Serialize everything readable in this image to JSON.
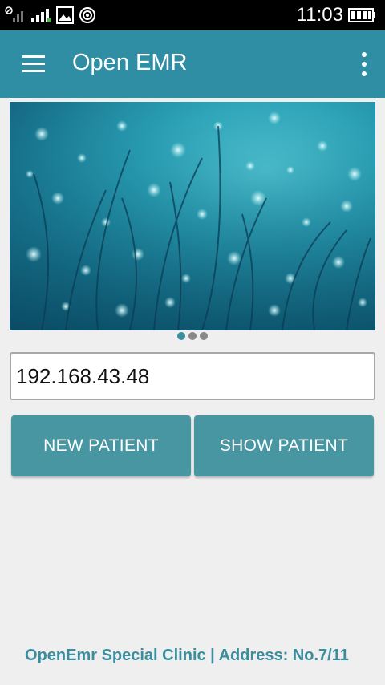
{
  "status_bar": {
    "time": "11:03",
    "icons": [
      "blocked-signal-icon",
      "signal-icon",
      "image-icon",
      "wifi-hotspot-icon",
      "battery-icon"
    ]
  },
  "app_bar": {
    "title": "Open EMR",
    "menu_icon": "hamburger-menu-icon",
    "overflow_icon": "more-vert-icon"
  },
  "banner": {
    "description_icon": "water-drops-grass-image",
    "page_indicator": {
      "count": 3,
      "active_index": 0
    }
  },
  "server_ip": {
    "value": "192.168.43.48"
  },
  "buttons": {
    "new_patient": "NEW PATIENT",
    "show_patient": "SHOW PATIENT"
  },
  "footer": {
    "text": "OpenEmr Special Clinic | Address: No.7/11"
  },
  "colors": {
    "primary": "#2f8ea4",
    "button": "#4896a1",
    "footer_text": "#3a8e9e",
    "background": "#efefef"
  }
}
